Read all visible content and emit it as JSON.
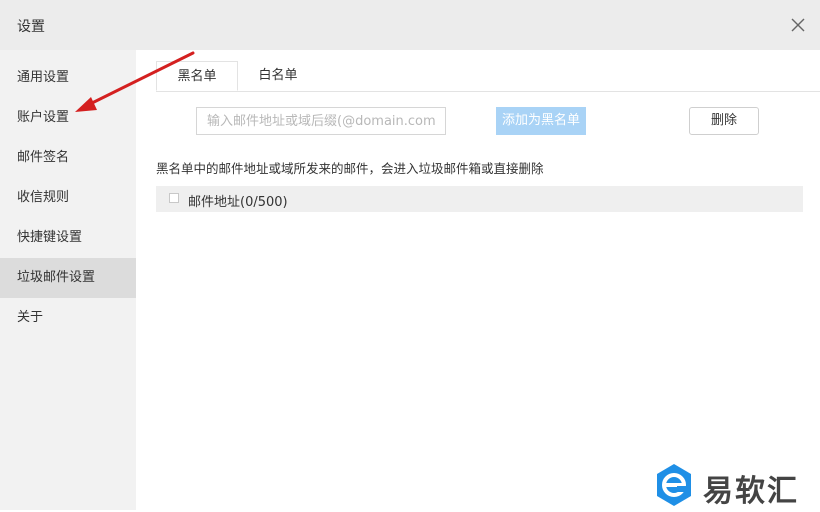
{
  "window": {
    "title": "设置"
  },
  "sidebar": {
    "items": [
      {
        "label": "通用设置",
        "active": false
      },
      {
        "label": "账户设置",
        "active": false
      },
      {
        "label": "邮件签名",
        "active": false
      },
      {
        "label": "收信规则",
        "active": false
      },
      {
        "label": "快捷键设置",
        "active": false
      },
      {
        "label": "垃圾邮件设置",
        "active": true
      },
      {
        "label": "关于",
        "active": false
      }
    ]
  },
  "tabs": [
    {
      "label": "黑名单",
      "active": true
    },
    {
      "label": "白名单",
      "active": false
    }
  ],
  "toolbar": {
    "input_placeholder": "输入邮件地址或域后缀(@domain.com)",
    "input_value": "",
    "add_label": "添加为黑名单",
    "delete_label": "删除"
  },
  "description": "黑名单中的邮件地址或域所发来的邮件，会进入垃圾邮件箱或直接删除",
  "list": {
    "header_label": "邮件地址(0/500)",
    "checked": false
  },
  "watermark": {
    "text": "易软汇"
  },
  "colors": {
    "accent_button": "#a9d3f6",
    "sidebar_bg": "#f2f2f2",
    "sidebar_active_bg": "#dcdcdc",
    "annotation_arrow": "#d42020"
  },
  "icons": {
    "close": "close-icon",
    "watermark_logo": "e-hexagon-logo-icon"
  }
}
